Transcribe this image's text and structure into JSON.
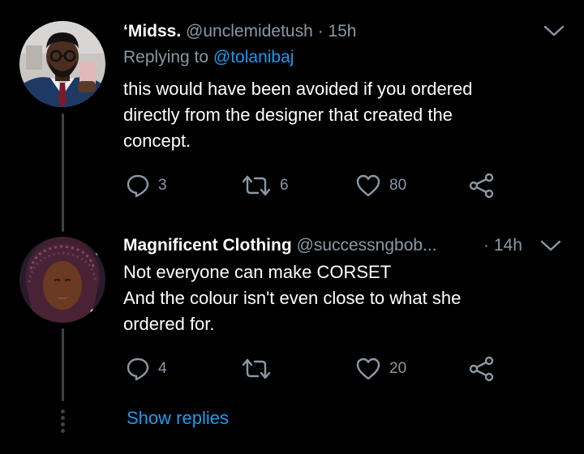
{
  "tweets": [
    {
      "display_name": "‘Midss.",
      "handle": "@unclemidetush",
      "separator": "·",
      "time": "15h",
      "replying_prefix": "Replying to",
      "replying_to": "@tolanibaj",
      "text_lines": [
        "this would have been avoided if you ordered",
        "directly from the designer that created the",
        "concept."
      ],
      "replies": "3",
      "retweets": "6",
      "likes": "80"
    },
    {
      "display_name": "Magnificent Clothing",
      "handle": "@successngbob...",
      "separator": "·",
      "time": "14h",
      "text_lines": [
        "Not everyone can make CORSET",
        "And the colour isn't even close to what she",
        "ordered for."
      ],
      "replies": "4",
      "retweets": "",
      "likes": "20"
    }
  ],
  "show_replies_label": "Show replies",
  "icons": {
    "reply": "reply-icon",
    "retweet": "retweet-icon",
    "like": "heart-icon",
    "share": "share-icon",
    "more": "chevron-down-icon"
  },
  "colors": {
    "background": "#000000",
    "text": "#ffffff",
    "muted": "#8b98a5",
    "link": "#1d9bf0",
    "thread_line": "#3d4148"
  }
}
